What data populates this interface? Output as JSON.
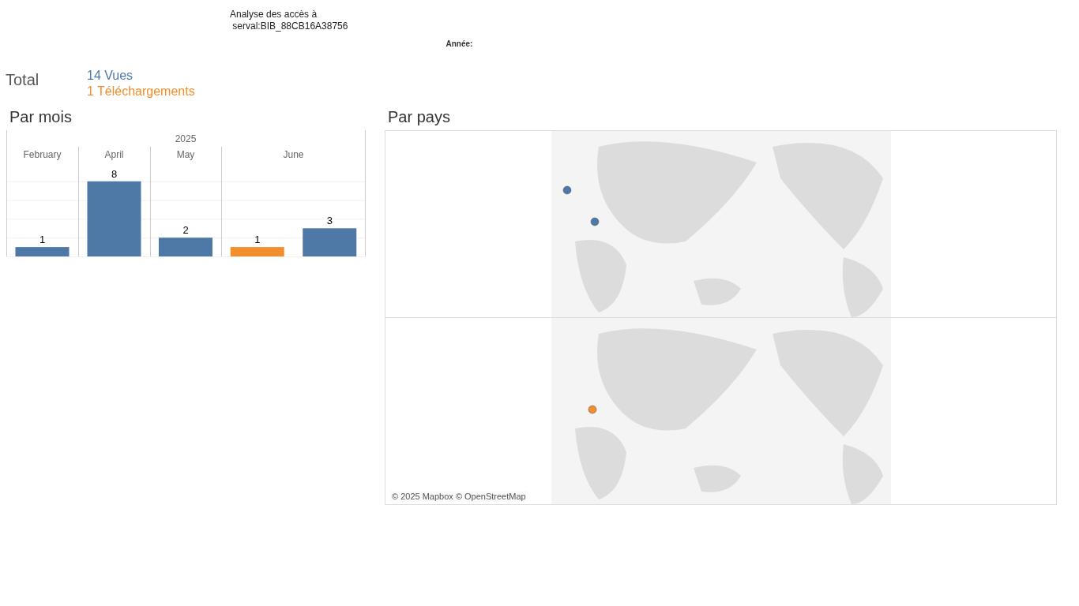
{
  "header": {
    "title": "Analyse des accès à\n serval:BIB_88CB16A38756",
    "year_label": "Année:"
  },
  "total": {
    "label": "Total",
    "views": "14 Vues",
    "downloads": "1 Téléchargements"
  },
  "by_month": {
    "title": "Par mois",
    "chart_data": {
      "type": "bar",
      "title": "2025",
      "categories": [
        "February",
        "April",
        "May",
        "June"
      ],
      "series": [
        {
          "color": "#f28e2b",
          "values": [
            null,
            null,
            null,
            1
          ]
        },
        {
          "color": "#4e79a7",
          "values": [
            1,
            8,
            2,
            3
          ]
        }
      ],
      "data_labels": true
    }
  },
  "by_country": {
    "title": "Par pays",
    "attribution": "© 2025 Mapbox © OpenStreetMap"
  }
}
